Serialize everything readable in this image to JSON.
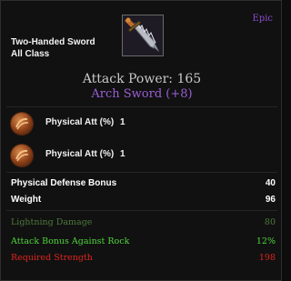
{
  "item": {
    "rarity": "Epic",
    "type": "Two-Handed Sword",
    "class": "All Class",
    "attack_power": "Attack Power: 165",
    "name": "Arch Sword (+8)",
    "icon": "sword-icon"
  },
  "gems": [
    {
      "icon": "gem-icon",
      "label": "Physical Att (%)",
      "value": "1"
    },
    {
      "icon": "gem-icon",
      "label": "Physical Att (%)",
      "value": "1"
    }
  ],
  "stats": [
    {
      "label": "Physical Defense Bonus",
      "value": "40"
    },
    {
      "label": "Weight",
      "value": "96"
    }
  ],
  "bonuses": [
    {
      "label": "Lightning Damage",
      "value": "80",
      "color": "#4e7a3c"
    },
    {
      "label": "Attack Bonus Against Rock",
      "value": "12%",
      "color": "#4fd63b"
    },
    {
      "label": "Required Strength",
      "value": "198",
      "color": "#e0241d"
    }
  ],
  "colors": {
    "epic": "#8a4dc9",
    "item_name": "#9a5fd6"
  }
}
